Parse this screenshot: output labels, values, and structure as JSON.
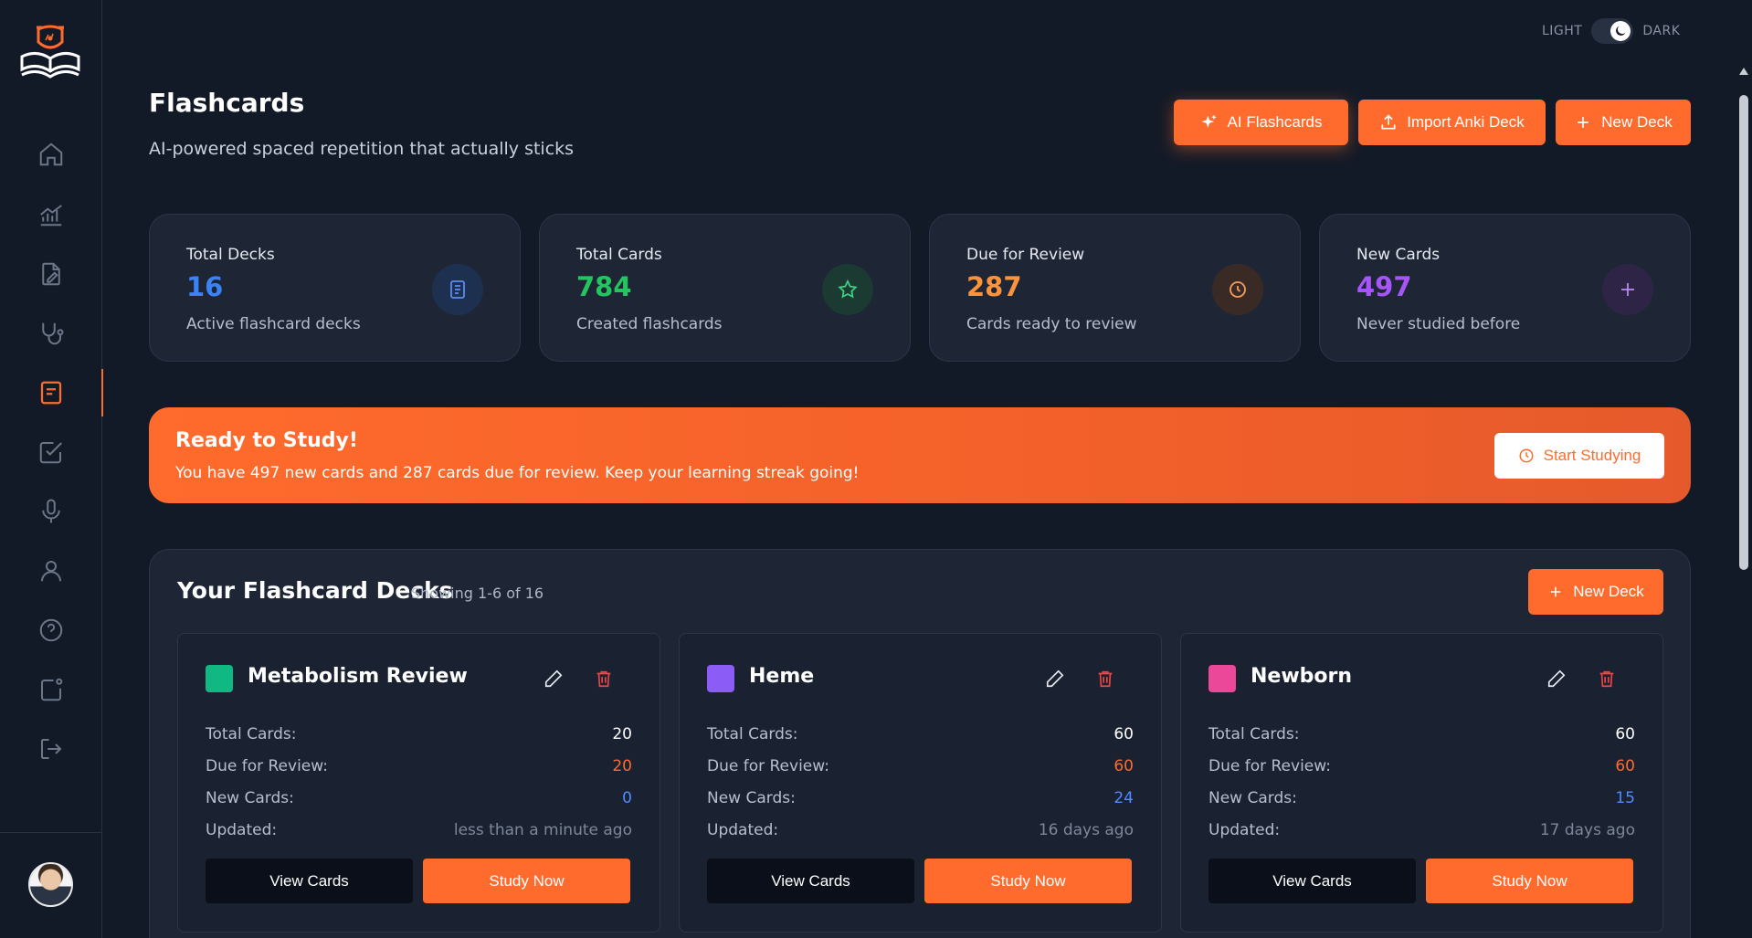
{
  "sidebar": {
    "logo_icon": "graduation-logo-icon",
    "items": [
      {
        "name": "home",
        "icon": "home-icon",
        "active": false
      },
      {
        "name": "analytics",
        "icon": "chart-icon",
        "active": false
      },
      {
        "name": "notes",
        "icon": "document-edit-icon",
        "active": false
      },
      {
        "name": "clinical",
        "icon": "stethoscope-icon",
        "active": false
      },
      {
        "name": "flashcards",
        "icon": "flashcard-icon",
        "active": true
      },
      {
        "name": "tasks",
        "icon": "checkbox-icon",
        "active": false
      },
      {
        "name": "voice",
        "icon": "microphone-icon",
        "active": false
      },
      {
        "name": "profile",
        "icon": "user-icon",
        "active": false
      },
      {
        "name": "help",
        "icon": "help-icon",
        "active": false
      },
      {
        "name": "notifications",
        "icon": "notification-icon",
        "active": false
      },
      {
        "name": "logout",
        "icon": "logout-icon",
        "active": false
      }
    ]
  },
  "theme": {
    "light_label": "LIGHT",
    "dark_label": "DARK",
    "mode": "dark"
  },
  "header": {
    "title": "Flashcards",
    "subtitle": "AI-powered spaced repetition that actually sticks",
    "ai_button": "AI Flashcards",
    "import_button": "Import Anki Deck",
    "new_deck_button": "New Deck"
  },
  "stats": [
    {
      "label": "Total Decks",
      "value": "16",
      "desc": "Active flashcard decks",
      "color": "#3b82f6",
      "icon": "document-icon"
    },
    {
      "label": "Total Cards",
      "value": "784",
      "desc": "Created flashcards",
      "color": "#22c55e",
      "icon": "star-icon"
    },
    {
      "label": "Due for Review",
      "value": "287",
      "desc": "Cards ready to review",
      "color": "#fb923c",
      "icon": "clock-icon"
    },
    {
      "label": "New Cards",
      "value": "497",
      "desc": "Never studied before",
      "color": "#a855f7",
      "icon": "plus-icon"
    }
  ],
  "banner": {
    "title": "Ready to Study!",
    "text": "You have 497 new cards and 287 cards due for review. Keep your learning streak going!",
    "button": "Start Studying"
  },
  "decks": {
    "title": "Your Flashcard Decks",
    "showing": "Showing 1-6 of 16",
    "new_button": "New Deck",
    "labels": {
      "total": "Total Cards:",
      "due": "Due for Review:",
      "new": "New Cards:",
      "updated": "Updated:"
    },
    "view_label": "View Cards",
    "study_label": "Study Now",
    "items": [
      {
        "name": "Metabolism Review",
        "color": "#10b981",
        "total": "20",
        "due": "20",
        "new": "0",
        "updated": "less than a minute ago"
      },
      {
        "name": "Heme",
        "color": "#8b5cf6",
        "total": "60",
        "due": "60",
        "new": "24",
        "updated": "16 days ago"
      },
      {
        "name": "Newborn",
        "color": "#ec4899",
        "total": "60",
        "due": "60",
        "new": "15",
        "updated": "17 days ago"
      }
    ]
  },
  "colors": {
    "accent": "#ff6b2c",
    "due": "#ff6b2c",
    "new": "#4f8cff"
  }
}
